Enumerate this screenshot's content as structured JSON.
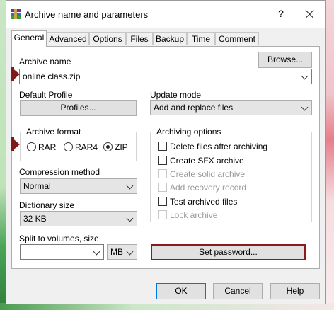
{
  "window": {
    "title": "Archive name and parameters",
    "help": "?"
  },
  "tabs": [
    "General",
    "Advanced",
    "Options",
    "Files",
    "Backup",
    "Time",
    "Comment"
  ],
  "archive_name": {
    "label": "Archive name",
    "value": "online class.zip",
    "browse": "Browse..."
  },
  "default_profile": {
    "label": "Default Profile",
    "button": "Profiles..."
  },
  "update_mode": {
    "label": "Update mode",
    "value": "Add and replace files"
  },
  "archive_format": {
    "label": "Archive format",
    "options": [
      "RAR",
      "RAR4",
      "ZIP"
    ],
    "selected": "ZIP"
  },
  "archiving_options": {
    "label": "Archiving options",
    "items": [
      {
        "label": "Delete files after archiving",
        "checked": false,
        "enabled": true
      },
      {
        "label": "Create SFX archive",
        "checked": false,
        "enabled": true
      },
      {
        "label": "Create solid archive",
        "checked": false,
        "enabled": false
      },
      {
        "label": "Add recovery record",
        "checked": false,
        "enabled": false
      },
      {
        "label": "Test archived files",
        "checked": false,
        "enabled": true
      },
      {
        "label": "Lock archive",
        "checked": false,
        "enabled": false
      }
    ]
  },
  "compression": {
    "label": "Compression method",
    "value": "Normal"
  },
  "dictionary": {
    "label": "Dictionary size",
    "value": "32 KB"
  },
  "split": {
    "label": "Split to volumes, size",
    "value": "",
    "unit": "MB"
  },
  "set_password": "Set password...",
  "footer": {
    "ok": "OK",
    "cancel": "Cancel",
    "help": "Help"
  },
  "colors": {
    "marker": "#7e1a1a",
    "password_border": "#8b1c1c"
  }
}
